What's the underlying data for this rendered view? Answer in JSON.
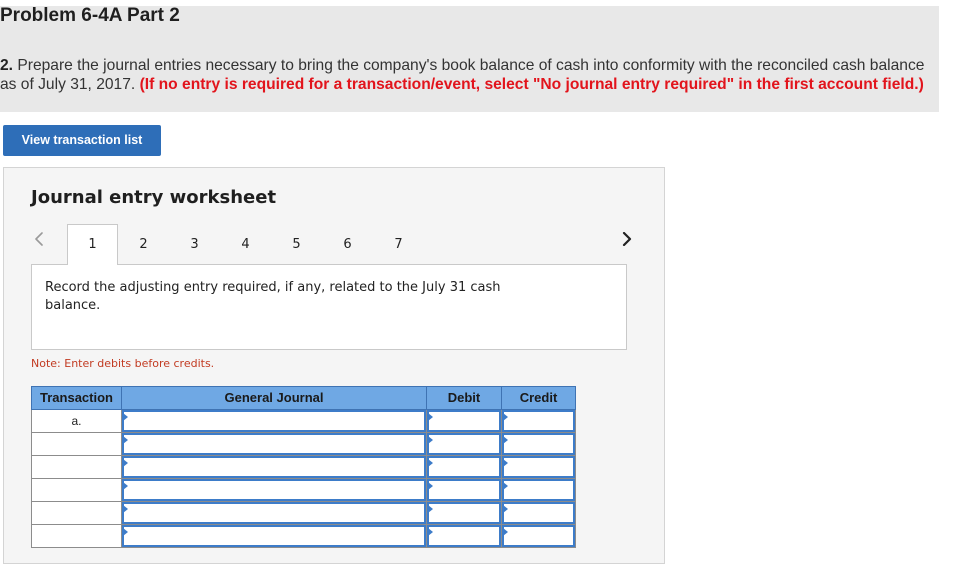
{
  "page": {
    "title": "Problem 6-4A Part 2"
  },
  "question": {
    "number": "2.",
    "text": "Prepare the journal entries necessary to bring the company's book balance of cash into conformity with the reconciled cash balance as of July 31, 2017.",
    "instruction": "(If no entry is required for a transaction/event, select \"No journal entry required\" in the first account field.)"
  },
  "toolbar": {
    "view_transactions_label": "View transaction list"
  },
  "worksheet": {
    "heading": "Journal entry worksheet",
    "prev_icon": "chevron-left-icon",
    "next_icon": "chevron-right-icon",
    "tabs": [
      "1",
      "2",
      "3",
      "4",
      "5",
      "6",
      "7"
    ],
    "active_tab": "1",
    "prompt": "Record the adjusting entry required, if any, related to the July 31 cash balance.",
    "note": "Note: Enter debits before credits.",
    "table": {
      "columns": [
        "Transaction",
        "General Journal",
        "Debit",
        "Credit"
      ],
      "field_marker_icon": "triangle-marker-icon",
      "rows": [
        {
          "transaction": "a.",
          "account": "",
          "debit": "",
          "credit": ""
        },
        {
          "transaction": "",
          "account": "",
          "debit": "",
          "credit": ""
        },
        {
          "transaction": "",
          "account": "",
          "debit": "",
          "credit": ""
        },
        {
          "transaction": "",
          "account": "",
          "debit": "",
          "credit": ""
        },
        {
          "transaction": "",
          "account": "",
          "debit": "",
          "credit": ""
        },
        {
          "transaction": "",
          "account": "",
          "debit": "",
          "credit": ""
        }
      ]
    }
  },
  "colors": {
    "question_band": "#e8e8e8",
    "button_blue": "#2e6eb8",
    "instruction_red": "#e2141c",
    "note_red": "#c23b22",
    "table_header_blue": "#6fa8e4",
    "field_border_blue": "#3d7cc9"
  }
}
